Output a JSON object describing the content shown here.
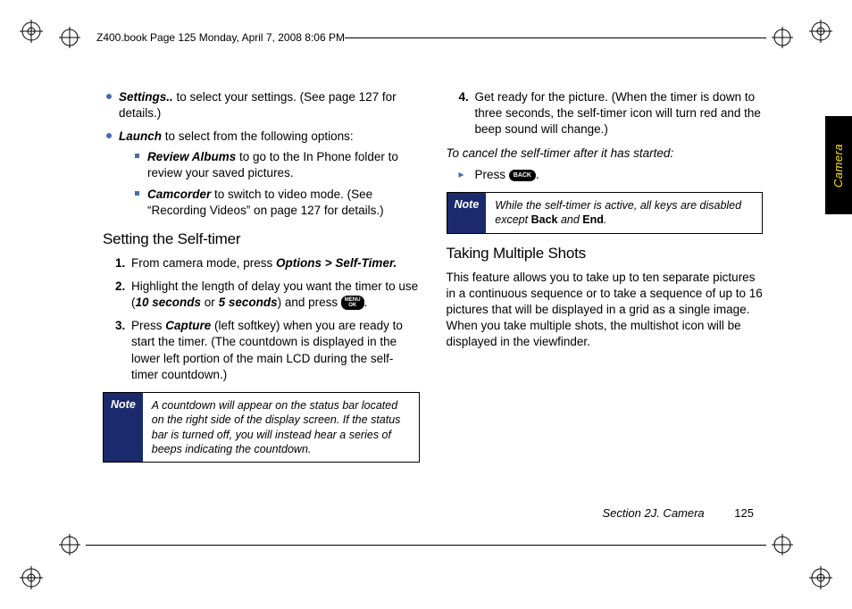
{
  "header": {
    "book_line": "Z400.book  Page 125  Monday, April 7, 2008  8:06 PM"
  },
  "side_tab": "Camera",
  "footer": {
    "section": "Section 2J. Camera",
    "page": "125"
  },
  "col1": {
    "opts": {
      "settings_bold": "Settings..",
      "settings_rest": " to select your settings. (See page 127 for details.)",
      "launch_bold": "Launch",
      "launch_rest": " to select from the following options:",
      "review_bold": "Review Albums",
      "review_rest": " to go to the In Phone folder to review your saved pictures.",
      "camcorder_bold": "Camcorder",
      "camcorder_rest": " to switch to video mode. (See “Recording Videos” on page 127 for details.)"
    },
    "h_selftimer": "Setting the Self-timer",
    "steps": {
      "s1_a": "From camera mode, press ",
      "s1_b": "Options > Self-Timer.",
      "s2_a": "Highlight the length of delay you want the timer to use (",
      "s2_b": "10 seconds",
      "s2_c": " or ",
      "s2_d": "5 seconds",
      "s2_e": ") and press ",
      "s2_key1": "MENU",
      "s2_key2": "OK",
      "s2_f": ".",
      "s3_a": "Press ",
      "s3_b": "Capture",
      "s3_c": " (left softkey) when you are ready to start the timer. (The countdown is displayed in the lower left portion of the main LCD during the self-timer countdown.)"
    },
    "note_label": "Note",
    "note_body": "A countdown will appear on the status bar located on the right side of the display screen. If the status bar is turned off, you will instead hear a series of beeps indicating the countdown."
  },
  "col2": {
    "step4": "Get ready for the picture. (When the timer is down to three seconds, the self-timer icon will turn red and the beep sound will change.)",
    "cancel_line": "To cancel the self-timer after it has started:",
    "press_a": "Press ",
    "press_key": "BACK",
    "press_b": ".",
    "note_label": "Note",
    "note_body_a": "While the self-timer is active, all keys are disabled except ",
    "note_body_b": "Back",
    "note_body_c": " and ",
    "note_body_d": "End",
    "note_body_e": ".",
    "h_multi": "Taking Multiple Shots",
    "multi_p": "This feature allows you to take up to ten separate pictures in a continuous sequence or to take a sequence of up to 16 pictures that will be displayed in a grid as a single image. When you take multiple shots, the multishot icon will be displayed in the viewfinder."
  }
}
